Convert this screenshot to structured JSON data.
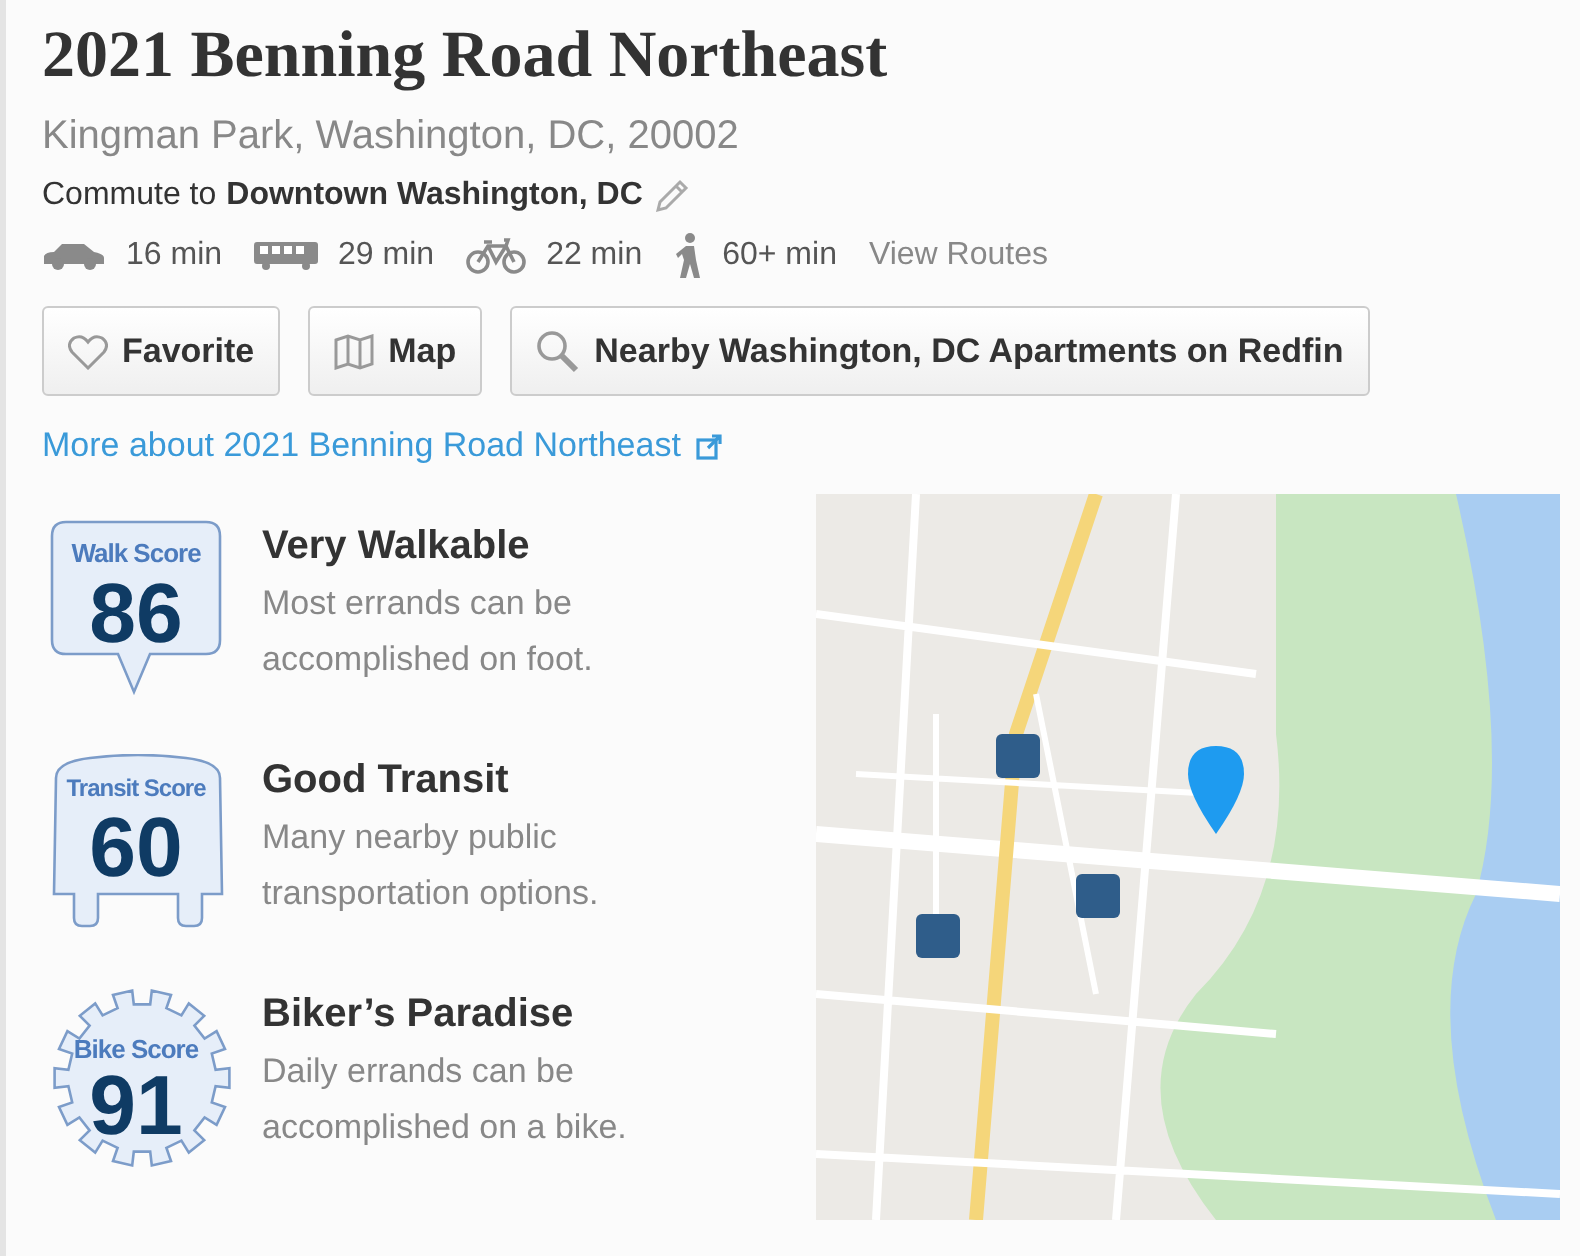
{
  "title": "2021 Benning Road Northeast",
  "address": "Kingman Park, Washington, DC, 20002",
  "commute": {
    "label": "Commute to",
    "destination": "Downtown Washington, DC"
  },
  "modes": [
    {
      "kind": "car",
      "time": "16 min"
    },
    {
      "kind": "bus",
      "time": "29 min"
    },
    {
      "kind": "bike",
      "time": "22 min"
    },
    {
      "kind": "walk",
      "time": "60+ min"
    }
  ],
  "view_routes": "View Routes",
  "buttons": [
    {
      "kind": "favorite",
      "label": "Favorite"
    },
    {
      "kind": "map",
      "label": "Map"
    },
    {
      "kind": "search",
      "label": "Nearby Washington, DC Apartments on Redfin"
    }
  ],
  "more_link": "More about 2021 Benning Road Northeast",
  "scores": [
    {
      "kind": "walk",
      "label": "Walk Score",
      "value": "86",
      "title": "Very Walkable",
      "description": "Most errands can be accomplished on foot."
    },
    {
      "kind": "transit",
      "label": "Transit Score",
      "value": "60",
      "title": "Good Transit",
      "description": "Many nearby public transportation options."
    },
    {
      "kind": "bike",
      "label": "Bike Score",
      "value": "91",
      "title": "Biker’s Paradise",
      "description": "Daily errands can be accomplished on a bike."
    }
  ]
}
